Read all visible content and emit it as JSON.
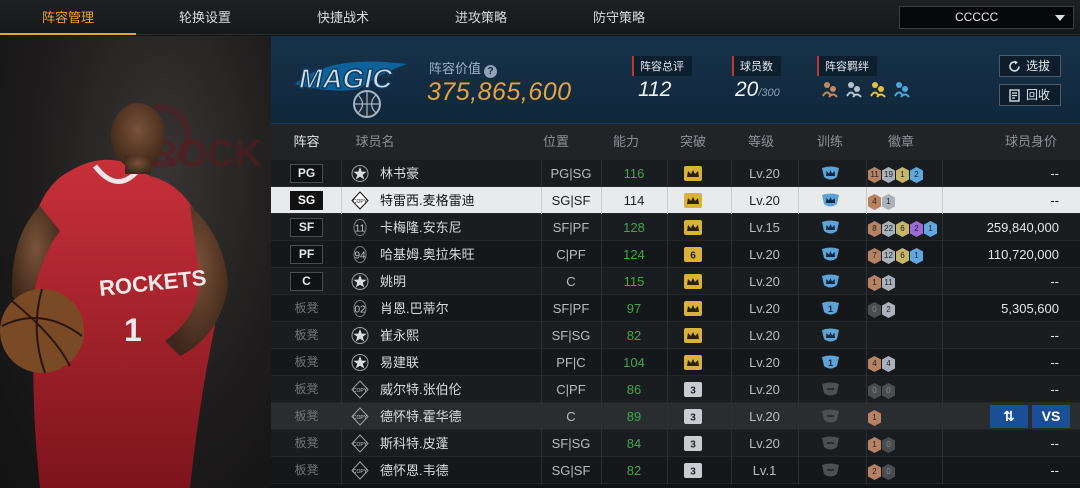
{
  "nav": {
    "tabs": [
      "阵容管理",
      "轮换设置",
      "快捷战术",
      "进攻策略",
      "防守策略"
    ],
    "active_index": 0,
    "team_select": "CCCCC"
  },
  "hero": {
    "jersey_text": "ROCKETS",
    "jersey_number": "1",
    "back_text": "ROCK"
  },
  "header": {
    "logo_text": "MAGIC",
    "value_label": "阵容价值",
    "value": "375,865,600",
    "rating_label": "阵容总评",
    "rating": "112",
    "players_label": "球员数",
    "players": "20",
    "players_max": "/300",
    "bond_label": "阵容羁绊",
    "select_label": "选拔",
    "recycle_label": "回收"
  },
  "table": {
    "headers": [
      "阵容",
      "球员名",
      "位置",
      "能力",
      "突破",
      "等级",
      "训练",
      "徽章",
      "球员身价"
    ],
    "rows": [
      {
        "slot": "PG",
        "bench": false,
        "card": "star",
        "name": "林书豪",
        "pos": "PG|SG",
        "ability": "116",
        "breakthrough": "crown",
        "level": "Lv.20",
        "training": "crown",
        "badges": [
          [
            "bronze",
            "11"
          ],
          [
            "silver",
            "19"
          ],
          [
            "gold",
            "1"
          ],
          [
            "blue",
            "2"
          ]
        ],
        "value": "--",
        "style": "odd"
      },
      {
        "slot": "SG",
        "bench": false,
        "card": "copy",
        "name": "特雷西.麦格雷迪",
        "pos": "SG|SF",
        "ability": "114",
        "breakthrough": "crown",
        "level": "Lv.20",
        "training": "crown",
        "badges": [
          [
            "bronze",
            "4"
          ],
          [
            "silver",
            "1"
          ]
        ],
        "value": "--",
        "style": "hl"
      },
      {
        "slot": "SF",
        "bench": false,
        "card": "11",
        "name": "卡梅隆.安东尼",
        "pos": "SF|PF",
        "ability": "128",
        "breakthrough": "crown",
        "level": "Lv.15",
        "training": "crown",
        "badges": [
          [
            "bronze",
            "8"
          ],
          [
            "silver",
            "22"
          ],
          [
            "gold",
            "6"
          ],
          [
            "purple",
            "2"
          ],
          [
            "blue",
            "1"
          ]
        ],
        "value": "259,840,000",
        "style": "odd"
      },
      {
        "slot": "PF",
        "bench": false,
        "card": "94",
        "name": "哈基姆.奥拉朱旺",
        "pos": "C|PF",
        "ability": "124",
        "breakthrough": "6",
        "level": "Lv.20",
        "training": "crown",
        "badges": [
          [
            "bronze",
            "7"
          ],
          [
            "silver",
            "12"
          ],
          [
            "gold",
            "6"
          ],
          [
            "blue",
            "1"
          ]
        ],
        "value": "110,720,000",
        "style": "even"
      },
      {
        "slot": "C",
        "bench": false,
        "card": "star",
        "name": "姚明",
        "pos": "C",
        "ability": "115",
        "breakthrough": "crown",
        "level": "Lv.20",
        "training": "crown",
        "badges": [
          [
            "bronze",
            "1"
          ],
          [
            "silver",
            "11"
          ]
        ],
        "value": "--",
        "style": "odd"
      },
      {
        "slot": "板凳",
        "bench": true,
        "card": "02",
        "name": "肖恩.巴蒂尔",
        "pos": "SF|PF",
        "ability": "97",
        "breakthrough": "crown",
        "level": "Lv.20",
        "training": "1",
        "badges": [
          [
            "dark",
            "0"
          ],
          [
            "silver",
            "2"
          ]
        ],
        "value": "5,305,600",
        "style": "even"
      },
      {
        "slot": "板凳",
        "bench": true,
        "card": "star",
        "name": "崔永熙",
        "pos": "SF|SG",
        "ability": "82",
        "breakthrough": "crown",
        "level": "Lv.20",
        "training": "crown",
        "badges": [],
        "value": "--",
        "style": "odd"
      },
      {
        "slot": "板凳",
        "bench": true,
        "card": "star",
        "name": "易建联",
        "pos": "PF|C",
        "ability": "104",
        "breakthrough": "crown",
        "level": "Lv.20",
        "training": "1",
        "badges": [
          [
            "bronze",
            "4"
          ],
          [
            "silver",
            "4"
          ]
        ],
        "value": "--",
        "style": "even"
      },
      {
        "slot": "板凳",
        "bench": true,
        "card": "copy",
        "name": "威尔特.张伯伦",
        "pos": "C|PF",
        "ability": "86",
        "breakthrough": "3",
        "level": "Lv.20",
        "training": "gray",
        "badges": [
          [
            "dark",
            "0"
          ],
          [
            "dark",
            "0"
          ]
        ],
        "value": "--",
        "style": "odd"
      },
      {
        "slot": "板凳",
        "bench": true,
        "card": "copy",
        "name": "德怀特.霍华德",
        "pos": "C",
        "ability": "89",
        "breakthrough": "3",
        "level": "Lv.20",
        "training": "gray",
        "badges": [
          [
            "bronze",
            "1"
          ]
        ],
        "value": "",
        "style": "dim",
        "actions": [
          "⇅",
          "VS"
        ]
      },
      {
        "slot": "板凳",
        "bench": true,
        "card": "copy",
        "name": "斯科特.皮蓬",
        "pos": "SF|SG",
        "ability": "84",
        "breakthrough": "3",
        "level": "Lv.20",
        "training": "gray",
        "badges": [
          [
            "bronze",
            "1"
          ],
          [
            "dark",
            "0"
          ]
        ],
        "value": "--",
        "style": "odd"
      },
      {
        "slot": "板凳",
        "bench": true,
        "card": "copy",
        "name": "德怀恩.韦德",
        "pos": "SG|SF",
        "ability": "82",
        "breakthrough": "3",
        "level": "Lv.1",
        "training": "gray",
        "badges": [
          [
            "bronze",
            "2"
          ],
          [
            "dark",
            "0"
          ]
        ],
        "value": "--",
        "style": "even"
      }
    ]
  },
  "colors": {
    "accent": "#e8a33a",
    "green": "#3fa64a",
    "action_blue": "#1a4f96"
  }
}
